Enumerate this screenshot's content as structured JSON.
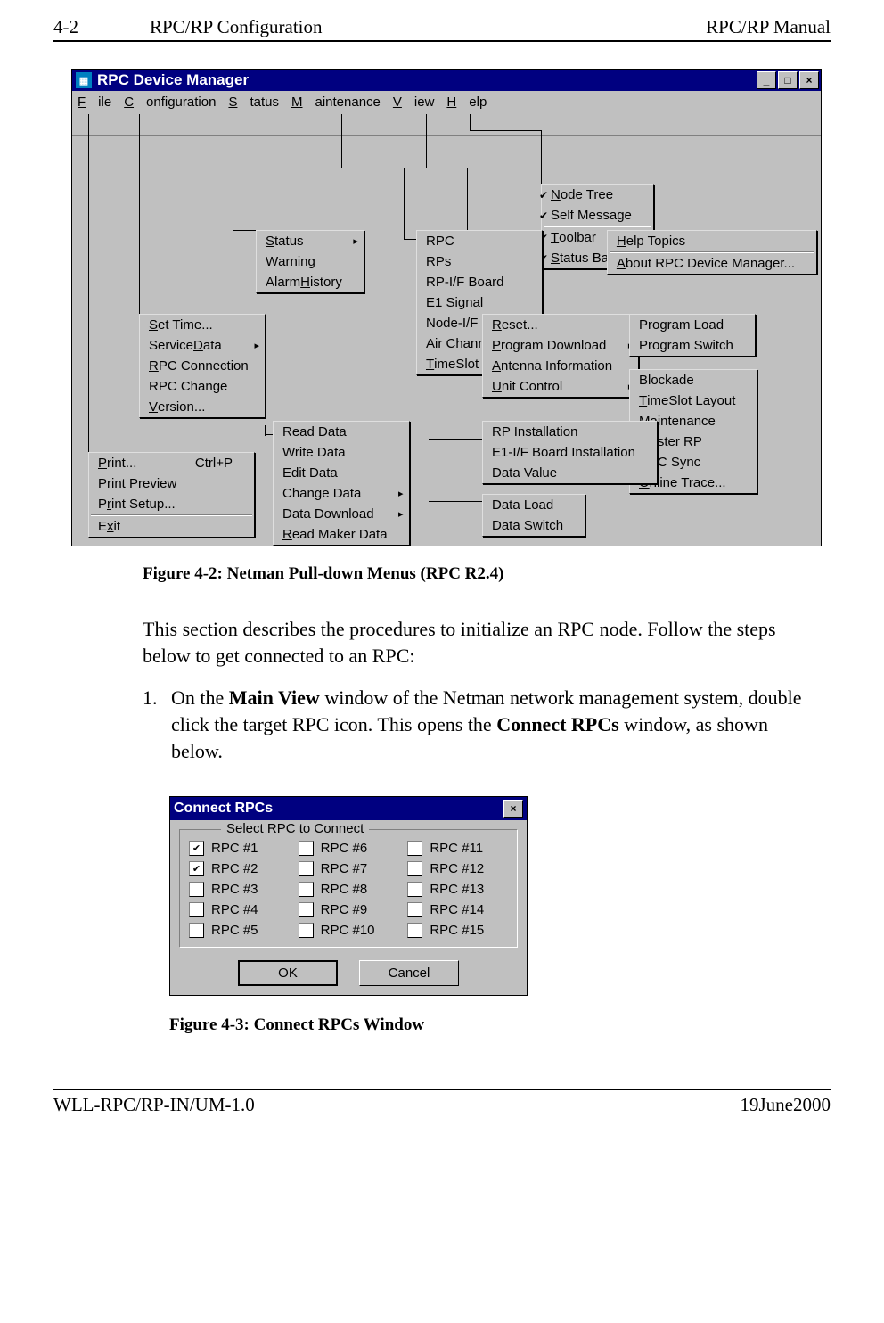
{
  "page": {
    "num": "4-2",
    "section": "RPC/RP Configuration",
    "manual": "RPC/RP Manual"
  },
  "appwin": {
    "title": "RPC Device Manager",
    "menus": {
      "file": "File",
      "config": "Configuration",
      "status": "Status",
      "maint": "Maintenance",
      "view": "View",
      "help": "Help"
    }
  },
  "drop": {
    "file": {
      "print": "Print...",
      "print_sc": "Ctrl+P",
      "preview": "Print Preview",
      "setup": "Print Setup...",
      "exit": "Exit"
    },
    "config": {
      "set_time": "Set Time...",
      "svc_data": "Service Data",
      "rpc_conn": "RPC Connection",
      "rpc_chg": "RPC Change",
      "version": "Version..."
    },
    "status": {
      "status": "Status",
      "warning": "Warning",
      "alarm": "Alarm History"
    },
    "status_sub": {
      "rpc": "RPC",
      "rps": "RPs",
      "rpif": "RP-I/F Board",
      "e1": "E1 Signal",
      "nodeif": "Node-I/F Board",
      "air": "Air Channel",
      "ts": "TimeSlot Status"
    },
    "maint": {
      "reset": "Reset...",
      "pdl": "Program Download",
      "ant": "Antenna Information",
      "unit": "Unit Control"
    },
    "pdl_sub": {
      "pl": "Program Load",
      "ps": "Program Switch"
    },
    "unit_sub": {
      "blk": "Blockade",
      "tsl": "TimeSlot Layout",
      "mnt": "Maintenance",
      "mstr": "Master RP",
      "sync": "RPC Sync",
      "trace": "Online Trace..."
    },
    "config_sub": {
      "read": "Read Data",
      "write": "Write Data",
      "edit": "Edit Data",
      "change": "Change Data",
      "ddl": "Data Download",
      "rmk": "Read Maker Data"
    },
    "ddl_sub": {
      "dl": "Data Load",
      "ds": "Data Switch"
    },
    "change_sub": {
      "rpinst": "RP Installation",
      "e1inst": "E1-I/F Board Installation",
      "dval": "Data Value"
    },
    "view": {
      "ntree": "Node Tree",
      "smsg": "Self Message",
      "tbar": "Toolbar",
      "sbar": "Status Bar"
    },
    "help": {
      "topics": "Help Topics",
      "about": "About RPC Device Manager..."
    }
  },
  "captions": {
    "fig1": "Figure 4-2: Netman Pull-down Menus (RPC R2.4)",
    "fig2": "Figure 4-3: Connect RPCs Window"
  },
  "para1": "This section describes the procedures to initialize an RPC node.   Follow the steps below to get connected to an RPC:",
  "step1": {
    "num": "1.",
    "a": "On the ",
    "b": "Main View",
    "c": " window of the Netman network management system, double click the target RPC icon.  This opens the ",
    "d": "Connect RPCs",
    "e": " window, as shown below."
  },
  "dialog": {
    "title": "Connect RPCs",
    "group": "Select RPC to Connect",
    "rpcs": [
      "RPC #1",
      "RPC #2",
      "RPC #3",
      "RPC #4",
      "RPC #5",
      "RPC #6",
      "RPC #7",
      "RPC #8",
      "RPC #9",
      "RPC #10",
      "RPC #11",
      "RPC #12",
      "RPC #13",
      "RPC #14",
      "RPC #15"
    ],
    "checked": [
      true,
      true,
      false,
      false,
      false,
      false,
      false,
      false,
      false,
      false,
      false,
      false,
      false,
      false,
      false
    ],
    "ok": "OK",
    "cancel": "Cancel"
  },
  "footer": {
    "left": "WLL-RPC/RP-IN/UM-1.0",
    "right": "19June2000"
  }
}
